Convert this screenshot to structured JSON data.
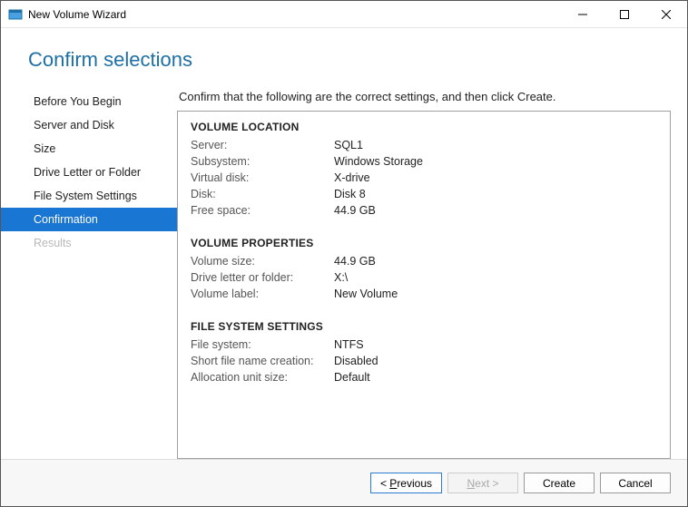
{
  "window": {
    "title": "New Volume Wizard"
  },
  "heading": "Confirm selections",
  "sidebar": {
    "items": [
      {
        "label": "Before You Begin",
        "state": "normal"
      },
      {
        "label": "Server and Disk",
        "state": "normal"
      },
      {
        "label": "Size",
        "state": "normal"
      },
      {
        "label": "Drive Letter or Folder",
        "state": "normal"
      },
      {
        "label": "File System Settings",
        "state": "normal"
      },
      {
        "label": "Confirmation",
        "state": "active"
      },
      {
        "label": "Results",
        "state": "disabled"
      }
    ]
  },
  "instruction": "Confirm that the following are the correct settings, and then click Create.",
  "sections": [
    {
      "title": "VOLUME LOCATION",
      "rows": [
        {
          "key": "Server:",
          "value": "SQL1"
        },
        {
          "key": "Subsystem:",
          "value": "Windows Storage"
        },
        {
          "key": "Virtual disk:",
          "value": "X-drive"
        },
        {
          "key": "Disk:",
          "value": "Disk 8"
        },
        {
          "key": "Free space:",
          "value": "44.9 GB"
        }
      ]
    },
    {
      "title": "VOLUME PROPERTIES",
      "rows": [
        {
          "key": "Volume size:",
          "value": "44.9 GB"
        },
        {
          "key": "Drive letter or folder:",
          "value": "X:\\"
        },
        {
          "key": "Volume label:",
          "value": "New Volume"
        }
      ]
    },
    {
      "title": "FILE SYSTEM SETTINGS",
      "rows": [
        {
          "key": "File system:",
          "value": "NTFS"
        },
        {
          "key": "Short file name creation:",
          "value": "Disabled"
        },
        {
          "key": "Allocation unit size:",
          "value": "Default"
        }
      ]
    }
  ],
  "buttons": {
    "previous": "Previous",
    "next": "Next >",
    "create": "Create",
    "cancel": "Cancel"
  }
}
